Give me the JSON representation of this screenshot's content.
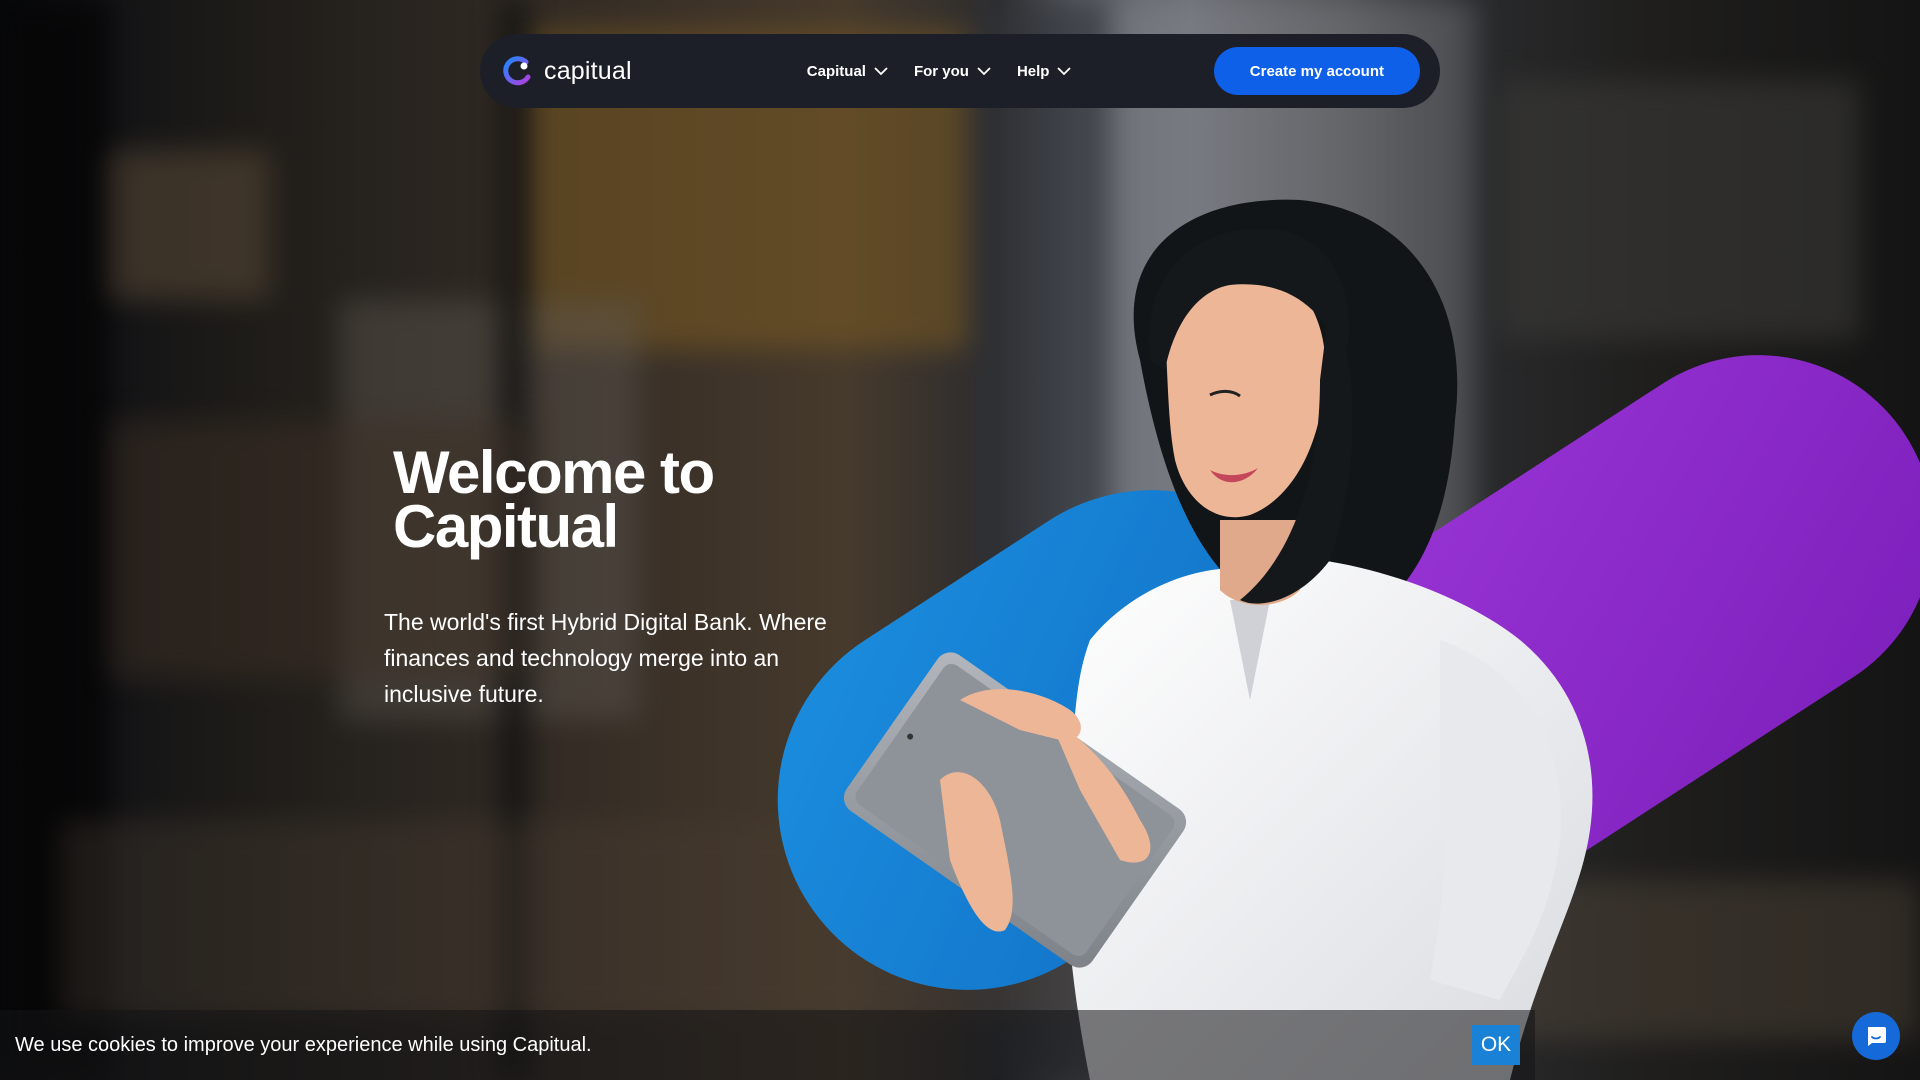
{
  "brand": {
    "name": "capitual"
  },
  "nav": {
    "items": [
      {
        "label": "Capitual"
      },
      {
        "label": "For you"
      },
      {
        "label": "Help"
      }
    ],
    "cta_label": "Create my account"
  },
  "hero": {
    "title_line1": "Welcome to",
    "title_line2": "Capitual",
    "subtitle": "The world's first Hybrid Digital Bank. Where finances and technology merge into an inclusive future."
  },
  "cookie": {
    "message": "We use cookies to improve your experience while using Capitual.",
    "ok_label": "OK"
  },
  "colors": {
    "nav_bg": "#1d1f28",
    "cta": "#0f60e8",
    "blob_blue": "#1582d4",
    "blob_purple": "#a43ad0",
    "chat": "#1669d9"
  },
  "icons": {
    "logo": "capitual-logo-icon",
    "dropdown": "chevron-down-icon",
    "chat": "chat-bubble-icon"
  }
}
